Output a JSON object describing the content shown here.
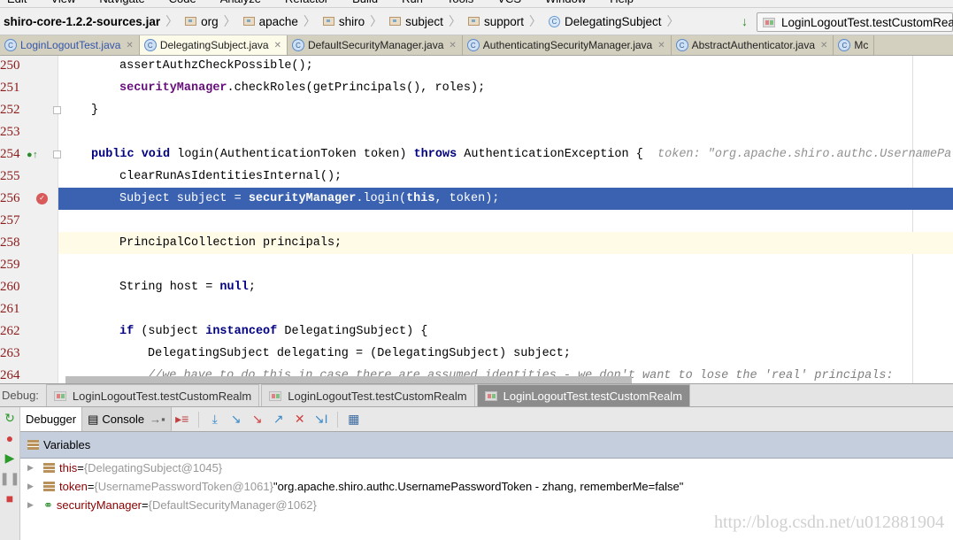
{
  "menu": [
    "Edit",
    "View",
    "Navigate",
    "Code",
    "Analyze",
    "Refactor",
    "Build",
    "Run",
    "Tools",
    "VCS",
    "Window",
    "Help"
  ],
  "breadcrumb": {
    "root": "shiro-core-1.2.2-sources.jar",
    "items": [
      "org",
      "apache",
      "shiro",
      "subject",
      "support"
    ],
    "class": "DelegatingSubject"
  },
  "run_config": "LoginLogoutTest.testCustomRealm",
  "editor_tabs": [
    {
      "label": "LoginLogoutTest.java",
      "active": false
    },
    {
      "label": "DelegatingSubject.java",
      "active": true
    },
    {
      "label": "DefaultSecurityManager.java",
      "active": false
    },
    {
      "label": "AuthenticatingSecurityManager.java",
      "active": false
    },
    {
      "label": "AbstractAuthenticator.java",
      "active": false
    },
    {
      "label": "Mc",
      "active": false
    }
  ],
  "code_lines": [
    {
      "n": "250",
      "indent": 2,
      "tokens": [
        {
          "t": "assertAuthzCheckPossible();",
          "c": "plain"
        }
      ]
    },
    {
      "n": "251",
      "indent": 2,
      "tokens": [
        {
          "t": "securityManager",
          "c": "field"
        },
        {
          "t": ".checkRoles(getPrincipals(), roles);",
          "c": "plain"
        }
      ]
    },
    {
      "n": "252",
      "indent": 1,
      "tokens": [
        {
          "t": "}",
          "c": "plain"
        }
      ]
    },
    {
      "n": "253",
      "indent": 0,
      "tokens": []
    },
    {
      "n": "254",
      "indent": 1,
      "tokens": [
        {
          "t": "public void ",
          "c": "kw"
        },
        {
          "t": "login(AuthenticationToken token) ",
          "c": "plain"
        },
        {
          "t": "throws ",
          "c": "kw"
        },
        {
          "t": "AuthenticationException {  ",
          "c": "plain"
        },
        {
          "t": "token: \"org.apache.shiro.authc.UsernamePa",
          "c": "hint"
        }
      ]
    },
    {
      "n": "255",
      "indent": 2,
      "tokens": [
        {
          "t": "clearRunAsIdentitiesInternal();",
          "c": "plain"
        }
      ]
    },
    {
      "n": "256",
      "indent": 2,
      "tokens": [
        {
          "t": "Subject subject = ",
          "c": "plain"
        },
        {
          "t": "securityManager",
          "c": "field"
        },
        {
          "t": ".login(",
          "c": "plain"
        },
        {
          "t": "this",
          "c": "kw"
        },
        {
          "t": ", token);",
          "c": "plain"
        }
      ]
    },
    {
      "n": "257",
      "indent": 0,
      "tokens": []
    },
    {
      "n": "258",
      "indent": 2,
      "tokens": [
        {
          "t": "PrincipalCollection principals;",
          "c": "plain"
        }
      ]
    },
    {
      "n": "259",
      "indent": 0,
      "tokens": []
    },
    {
      "n": "260",
      "indent": 2,
      "tokens": [
        {
          "t": "String host = ",
          "c": "plain"
        },
        {
          "t": "null",
          "c": "kw"
        },
        {
          "t": ";",
          "c": "plain"
        }
      ]
    },
    {
      "n": "261",
      "indent": 0,
      "tokens": []
    },
    {
      "n": "262",
      "indent": 2,
      "tokens": [
        {
          "t": "if ",
          "c": "kw"
        },
        {
          "t": "(subject ",
          "c": "plain"
        },
        {
          "t": "instanceof ",
          "c": "kw"
        },
        {
          "t": "DelegatingSubject) {",
          "c": "plain"
        }
      ]
    },
    {
      "n": "263",
      "indent": 3,
      "tokens": [
        {
          "t": "DelegatingSubject delegating = (DelegatingSubject) subject;",
          "c": "plain"
        }
      ]
    },
    {
      "n": "264",
      "indent": 3,
      "tokens": [
        {
          "t": "//we have to do this in case there are assumed identities - we don't want to lose the 'real' principals:",
          "c": "comment"
        }
      ]
    }
  ],
  "execution_line": "256",
  "breakpoint_line": "256",
  "caret_line": "258",
  "debug": {
    "label": "Debug:",
    "sessions": [
      {
        "label": "LoginLogoutTest.testCustomRealm",
        "active": false
      },
      {
        "label": "LoginLogoutTest.testCustomRealm",
        "active": false
      },
      {
        "label": "LoginLogoutTest.testCustomRealm",
        "active": true
      }
    ],
    "tabs": {
      "debugger": "Debugger",
      "console": "Console"
    },
    "variables_title": "Variables",
    "variables": [
      {
        "name": "this",
        "type": "{DelegatingSubject@1045}",
        "value": ""
      },
      {
        "name": "token",
        "type": "{UsernamePasswordToken@1061}",
        "value": "\"org.apache.shiro.authc.UsernamePasswordToken - zhang, rememberMe=false\""
      },
      {
        "name": "securityManager",
        "type": "{DefaultSecurityManager@1062}",
        "value": ""
      }
    ]
  },
  "watermark": "http://blog.csdn.net/u012881904"
}
